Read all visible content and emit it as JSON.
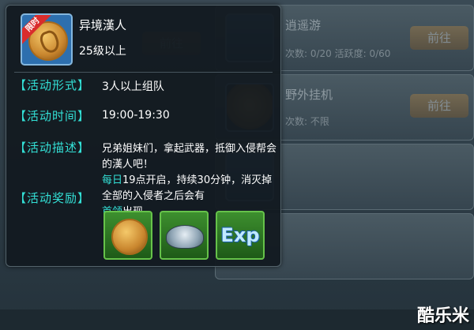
{
  "background": {
    "cards": [
      {
        "title": "逍遥游",
        "sub": "次数: 0/20    活跃度: 0/60",
        "button": "前往",
        "icon": "exp-icon"
      },
      {
        "title": "野外挂机",
        "sub": "次数: 不限",
        "button": "前往",
        "icon": "coin-icon"
      }
    ],
    "left_button": "前往"
  },
  "popup": {
    "badge": "限时",
    "name": "异境漢人",
    "level": "25级以上",
    "rows": {
      "form_label": "【活动形式】",
      "form_value": "3人以上组队",
      "time_label": "【活动时间】",
      "time_value": "19:00-19:30",
      "desc_label": "【活动描述】",
      "desc_line1": "兄弟姐妹们，拿起武器，抵御入侵帮会的漢人吧！",
      "desc_hl1": "每日",
      "desc_line2": "19点开启，持续30分钟，消灭掉全部的入侵者之后会有",
      "desc_hl2": "首领",
      "desc_line3": "出现。",
      "reward_label": "【活动奖励】"
    },
    "rewards": [
      {
        "icon": "coin-icon"
      },
      {
        "icon": "silver-ingot-icon"
      },
      {
        "icon": "exp-icon",
        "text": "Exp"
      }
    ]
  },
  "watermark": "酷乐米"
}
